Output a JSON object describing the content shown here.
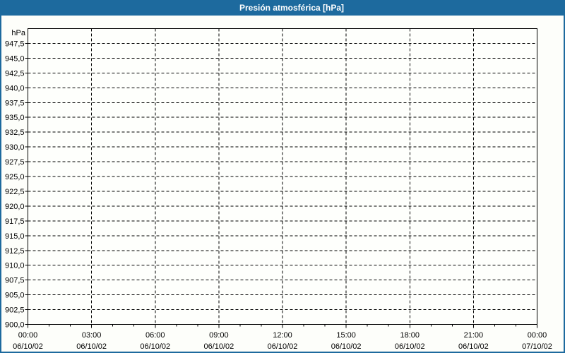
{
  "window": {
    "title": "Presión atmosférica [hPa]"
  },
  "colors": {
    "titlebar_bg": "#1d6a9e",
    "titlebar_text": "#ffffff",
    "frame_border": "#1d6a9e",
    "background": "#fdfefa",
    "plot_background": "#fefffc",
    "grid": "#000000",
    "axis": "#000000",
    "label_text": "#000000"
  },
  "chart_data": {
    "type": "line",
    "title": "Presión atmosférica [hPa]",
    "ylabel": "hPa",
    "xlabel": "",
    "ylim": [
      900,
      950
    ],
    "ytick_step": 2.5,
    "yticks": [
      {
        "value": 947.5,
        "label": "947,5"
      },
      {
        "value": 945.0,
        "label": "945,0"
      },
      {
        "value": 942.5,
        "label": "942,5"
      },
      {
        "value": 940.0,
        "label": "940,0"
      },
      {
        "value": 937.5,
        "label": "937,5"
      },
      {
        "value": 935.0,
        "label": "935,0"
      },
      {
        "value": 932.5,
        "label": "932,5"
      },
      {
        "value": 930.0,
        "label": "930,0"
      },
      {
        "value": 927.5,
        "label": "927,5"
      },
      {
        "value": 925.0,
        "label": "925,0"
      },
      {
        "value": 922.5,
        "label": "922,5"
      },
      {
        "value": 920.0,
        "label": "920,0"
      },
      {
        "value": 917.5,
        "label": "917,5"
      },
      {
        "value": 915.0,
        "label": "915,0"
      },
      {
        "value": 912.5,
        "label": "912,5"
      },
      {
        "value": 910.0,
        "label": "910,0"
      },
      {
        "value": 907.5,
        "label": "907,5"
      },
      {
        "value": 905.0,
        "label": "905,0"
      },
      {
        "value": 902.5,
        "label": "902,5"
      },
      {
        "value": 900.0,
        "label": "900,0"
      }
    ],
    "xlim_hours": [
      0,
      24
    ],
    "x_major_tick_interval_hours": 3,
    "x_minor_tick_interval_hours": 1,
    "xticks": [
      {
        "hour": 0,
        "time": "00:00",
        "date": "06/10/02"
      },
      {
        "hour": 3,
        "time": "03:00",
        "date": "06/10/02"
      },
      {
        "hour": 6,
        "time": "06:00",
        "date": "06/10/02"
      },
      {
        "hour": 9,
        "time": "09:00",
        "date": "06/10/02"
      },
      {
        "hour": 12,
        "time": "12:00",
        "date": "06/10/02"
      },
      {
        "hour": 15,
        "time": "15:00",
        "date": "06/10/02"
      },
      {
        "hour": 18,
        "time": "18:00",
        "date": "06/10/02"
      },
      {
        "hour": 21,
        "time": "21:00",
        "date": "06/10/02"
      },
      {
        "hour": 24,
        "time": "00:00",
        "date": "07/10/02"
      }
    ],
    "grid": "on",
    "grid_style": "dashed",
    "legend": "none",
    "series": []
  }
}
